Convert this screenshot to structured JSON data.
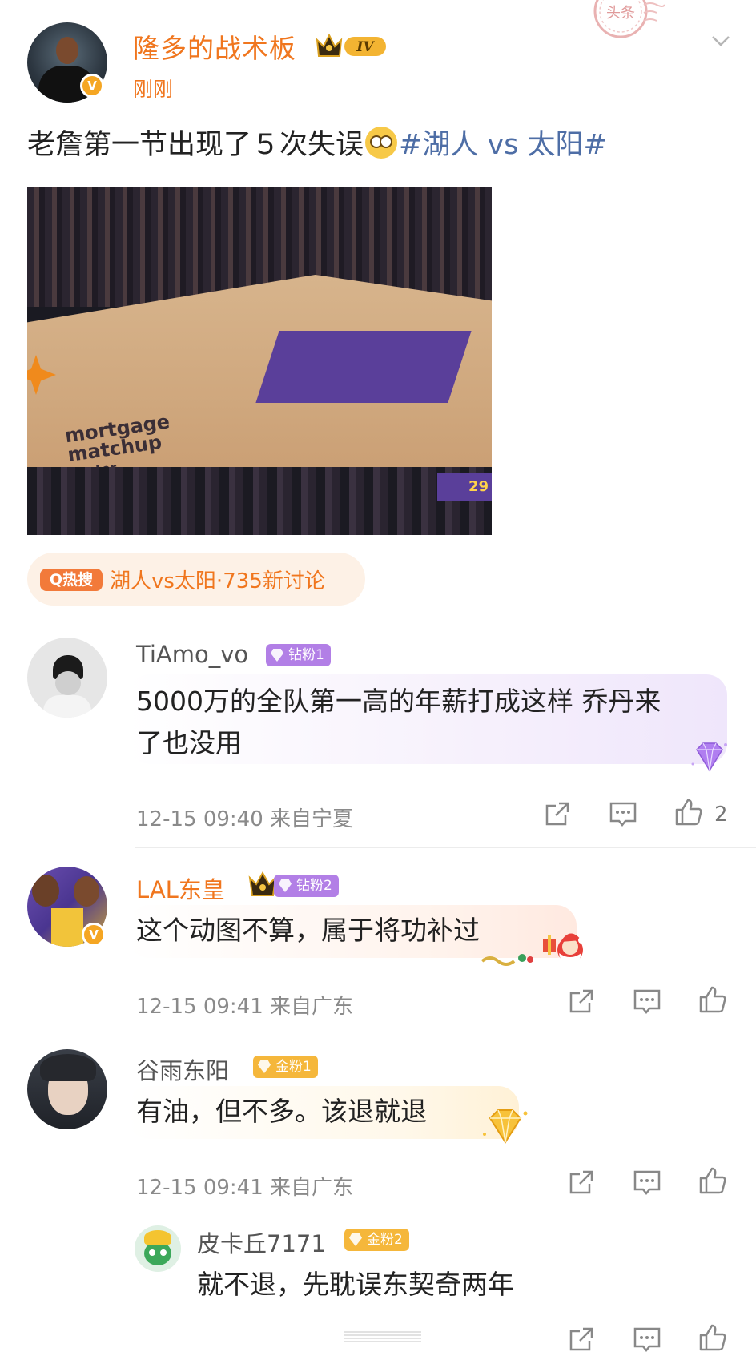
{
  "post": {
    "author": "隆多的战术板",
    "level_badge": "IV",
    "time": "刚刚",
    "text_before": "老詹第一节出现了５次失误",
    "hashtag": "#湖人 vs 太阳#",
    "video_logo_line1": "mortgage",
    "video_logo_line2": "matchup",
    "video_logo_line3": "center",
    "video_score": "29",
    "stamp_text": "头条"
  },
  "hot_search": {
    "tag": "Q热搜",
    "text": "湖人vs太阳·735新讨论"
  },
  "comments": [
    {
      "name": "TiAmo_vo",
      "badge": "钻粉1",
      "text_line1": "5000万的全队第一高的年薪打成这样 乔丹来",
      "text_line2": "了也没用",
      "meta": "12-15 09:40 来自宁夏",
      "likes": "2"
    },
    {
      "name": "LAL东皇",
      "badge": "钻粉2",
      "text_line1": "这个动图不算，属于将功补过",
      "meta": "12-15 09:41 来自广东",
      "likes": ""
    },
    {
      "name": "谷雨东阳",
      "badge": "金粉1",
      "text_line1": "有油，但不多。该退就退",
      "meta": "12-15 09:41 来自广东",
      "likes": ""
    },
    {
      "name": "皮卡丘7171",
      "badge": "金粉2",
      "text_line1": "就不退，先耽误东契奇两年",
      "meta": "",
      "likes": ""
    }
  ],
  "colors": {
    "orange": "#f0761e",
    "hashtag_blue": "#4e6ea6",
    "diamond_purple": "#a97ae8",
    "gold": "#f5b73b"
  },
  "icons": [
    "share-icon",
    "comment-icon",
    "like-icon",
    "chevron-down-icon",
    "verified-icon",
    "crown-icon"
  ]
}
